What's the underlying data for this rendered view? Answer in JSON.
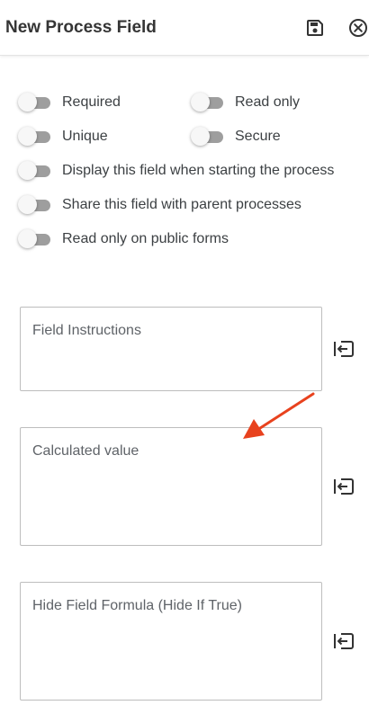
{
  "header": {
    "title": "New Process Field",
    "save_icon": "save-icon",
    "close_icon": "close-circle-icon"
  },
  "toggles": {
    "required": {
      "label": "Required",
      "on": false
    },
    "read_only": {
      "label": "Read only",
      "on": false
    },
    "unique": {
      "label": "Unique",
      "on": false
    },
    "secure": {
      "label": "Secure",
      "on": false
    },
    "display_on_start": {
      "label": "Display this field when starting the process",
      "on": false
    },
    "share_with_parent": {
      "label": "Share this field with parent processes",
      "on": false
    },
    "read_only_public": {
      "label": "Read only on public forms",
      "on": false
    }
  },
  "fields": {
    "instructions": {
      "placeholder": "Field Instructions",
      "value": ""
    },
    "calculated": {
      "placeholder": "Calculated value",
      "value": ""
    },
    "hide_formula": {
      "placeholder": "Hide Field Formula (Hide If True)",
      "value": ""
    }
  },
  "colors": {
    "toggle_track_off": "#9e9e9e",
    "toggle_knob": "#f7f7f7",
    "annotation_arrow": "#e8421e",
    "border": "#bdbdbd"
  }
}
